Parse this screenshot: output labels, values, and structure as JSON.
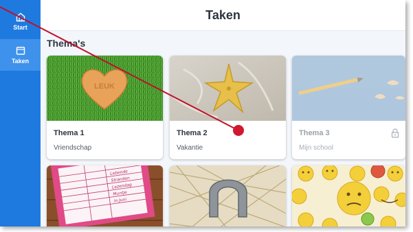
{
  "app": {
    "page_title": "Taken",
    "section_title": "Thema's"
  },
  "sidebar": {
    "items": [
      {
        "label": "Start",
        "icon": "home-icon",
        "active": false
      },
      {
        "label": "Taken",
        "icon": "window-icon",
        "active": true
      }
    ]
  },
  "cards": [
    {
      "title": "Thema 1",
      "subtitle": "Vriendschap",
      "image": "heart-on-grass",
      "locked": false,
      "heart_text": "LEUK"
    },
    {
      "title": "Thema 2",
      "subtitle": "Vakantie",
      "image": "starfish-on-sand",
      "locked": false
    },
    {
      "title": "Thema 3",
      "subtitle": "Mijn school",
      "image": "pencil-on-blue",
      "locked": true
    },
    {
      "image": "list-on-wood"
    },
    {
      "image": "horseshoe-on-straw"
    },
    {
      "image": "emoji-pattern"
    }
  ],
  "list_card": {
    "lines": [
      "Lebende",
      "Stranden",
      "Lezendag",
      "Muntje",
      "in Juni"
    ]
  },
  "colors": {
    "sidebar": "#1f7ae0",
    "sidebar_active": "#3f92ec",
    "annotation_line": "#c0102a"
  }
}
